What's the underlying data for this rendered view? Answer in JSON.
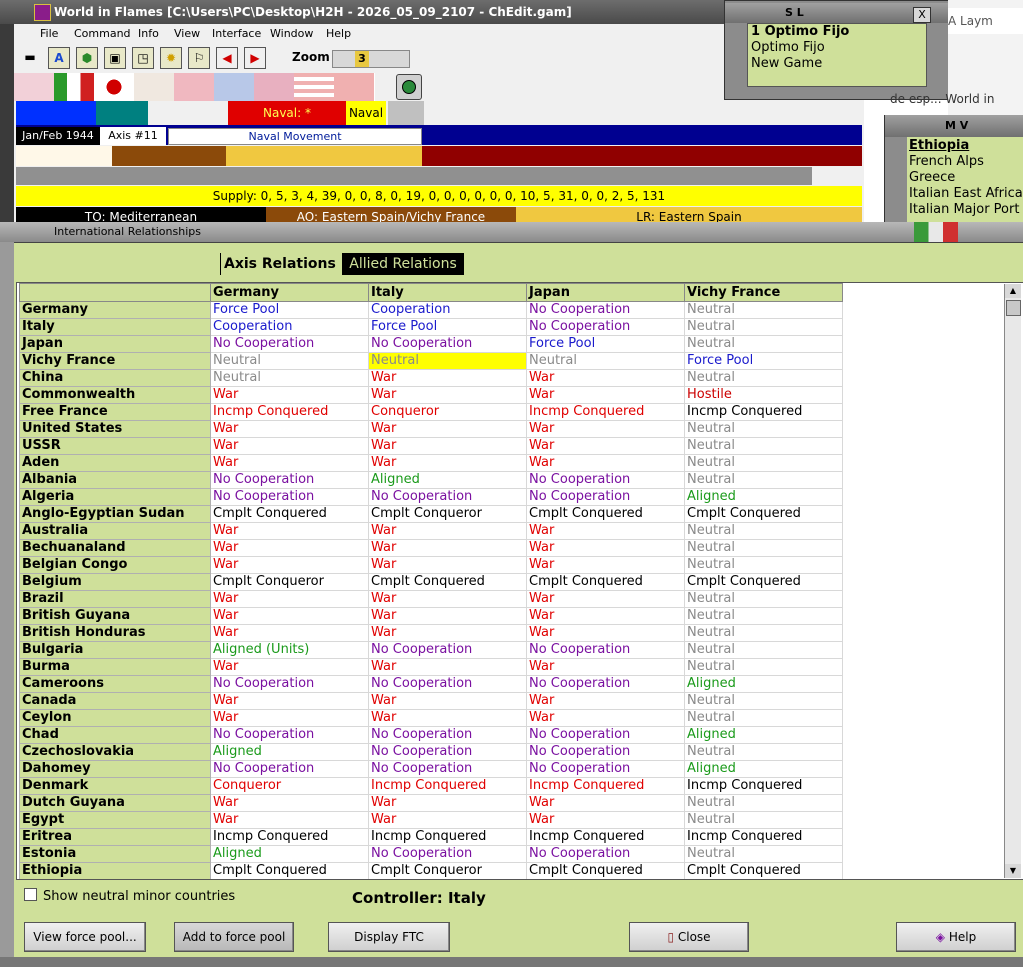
{
  "main_window": {
    "title": "World in Flames [C:\\Users\\PC\\Desktop\\H2H - 2026_05_09_2107 - ChEdit.gam]",
    "menu": [
      "File",
      "Command",
      "Info",
      "View",
      "Interface",
      "Window",
      "Help"
    ],
    "zoom_label": "Zoom",
    "zoom_value": "3",
    "naval_star": "Naval: *",
    "naval_tag": "Naval",
    "date": "Jan/Feb 1944",
    "axis_turn": "Axis #11",
    "phase": "Naval Movement",
    "supply": "Supply: 0, 5, 3, 4, 39, 0, 0, 8, 0, 19, 0, 0, 0, 0, 0, 0, 10, 5, 31, 0, 0, 2, 5, 131",
    "to": "TO: Mediterranean",
    "ao": "AO: Eastern Spain/Vichy France",
    "lr": "LR: Eastern Spain"
  },
  "sl_window": {
    "title": "S L",
    "close": "X",
    "lines": [
      "1 Optimo Fijo",
      "Optimo Fijo",
      "New Game"
    ]
  },
  "browser": {
    "tab_label": "A Laym",
    "row2": "de esp...   World in"
  },
  "mv_window": {
    "title": "M V",
    "items": [
      "Ethiopia",
      "French Alps",
      "Greece",
      "Italian East Africa",
      "Italian Major Port"
    ]
  },
  "ir_window": {
    "title": "International Relationships",
    "tab_axis": "Axis Relations",
    "tab_allied": "Allied Relations",
    "columns": [
      "Germany",
      "Italy",
      "Japan",
      "Vichy France"
    ],
    "rows": [
      {
        "name": "Germany",
        "cells": [
          [
            "Force Pool",
            "blue"
          ],
          [
            "Cooperation",
            "blue"
          ],
          [
            "No Cooperation",
            "purple"
          ],
          [
            "Neutral",
            "neutral"
          ]
        ]
      },
      {
        "name": "Italy",
        "cells": [
          [
            "Cooperation",
            "blue"
          ],
          [
            "Force Pool",
            "blue"
          ],
          [
            "No Cooperation",
            "purple"
          ],
          [
            "Neutral",
            "neutral"
          ]
        ]
      },
      {
        "name": "Japan",
        "cells": [
          [
            "No Cooperation",
            "purple"
          ],
          [
            "No Cooperation",
            "purple"
          ],
          [
            "Force Pool",
            "blue"
          ],
          [
            "Neutral",
            "neutral"
          ]
        ]
      },
      {
        "name": "Vichy France",
        "cells": [
          [
            "Neutral",
            "neutral"
          ],
          [
            "Neutral",
            "hl"
          ],
          [
            "Neutral",
            "neutral"
          ],
          [
            "Force Pool",
            "blue"
          ]
        ]
      },
      {
        "name": "China",
        "cells": [
          [
            "Neutral",
            "neutral"
          ],
          [
            "War",
            "war"
          ],
          [
            "War",
            "war"
          ],
          [
            "Neutral",
            "neutral"
          ]
        ]
      },
      {
        "name": "Commonwealth",
        "cells": [
          [
            "War",
            "war"
          ],
          [
            "War",
            "war"
          ],
          [
            "War",
            "war"
          ],
          [
            "Hostile",
            "red"
          ]
        ]
      },
      {
        "name": "Free France",
        "cells": [
          [
            "Incmp Conquered",
            "war"
          ],
          [
            "Conqueror",
            "war"
          ],
          [
            "Incmp Conquered",
            "war"
          ],
          [
            "Incmp Conquered",
            "black"
          ]
        ]
      },
      {
        "name": "United States",
        "cells": [
          [
            "War",
            "war"
          ],
          [
            "War",
            "war"
          ],
          [
            "War",
            "war"
          ],
          [
            "Neutral",
            "neutral"
          ]
        ]
      },
      {
        "name": "USSR",
        "cells": [
          [
            "War",
            "war"
          ],
          [
            "War",
            "war"
          ],
          [
            "War",
            "war"
          ],
          [
            "Neutral",
            "neutral"
          ]
        ]
      },
      {
        "name": "Aden",
        "cells": [
          [
            "War",
            "war"
          ],
          [
            "War",
            "war"
          ],
          [
            "War",
            "war"
          ],
          [
            "Neutral",
            "neutral"
          ]
        ]
      },
      {
        "name": "Albania",
        "cells": [
          [
            "No Cooperation",
            "purple"
          ],
          [
            "Aligned",
            "green"
          ],
          [
            "No Cooperation",
            "purple"
          ],
          [
            "Neutral",
            "neutral"
          ]
        ]
      },
      {
        "name": "Algeria",
        "cells": [
          [
            "No Cooperation",
            "purple"
          ],
          [
            "No Cooperation",
            "purple"
          ],
          [
            "No Cooperation",
            "purple"
          ],
          [
            "Aligned",
            "green"
          ]
        ]
      },
      {
        "name": "Anglo-Egyptian Sudan",
        "cells": [
          [
            "Cmplt Conquered",
            "black"
          ],
          [
            "Cmplt Conqueror",
            "black"
          ],
          [
            "Cmplt Conquered",
            "black"
          ],
          [
            "Cmplt Conquered",
            "black"
          ]
        ]
      },
      {
        "name": "Australia",
        "cells": [
          [
            "War",
            "war"
          ],
          [
            "War",
            "war"
          ],
          [
            "War",
            "war"
          ],
          [
            "Neutral",
            "neutral"
          ]
        ]
      },
      {
        "name": "Bechuanaland",
        "cells": [
          [
            "War",
            "war"
          ],
          [
            "War",
            "war"
          ],
          [
            "War",
            "war"
          ],
          [
            "Neutral",
            "neutral"
          ]
        ]
      },
      {
        "name": "Belgian Congo",
        "cells": [
          [
            "War",
            "war"
          ],
          [
            "War",
            "war"
          ],
          [
            "War",
            "war"
          ],
          [
            "Neutral",
            "neutral"
          ]
        ]
      },
      {
        "name": "Belgium",
        "cells": [
          [
            "Cmplt Conqueror",
            "black"
          ],
          [
            "Cmplt Conquered",
            "black"
          ],
          [
            "Cmplt Conquered",
            "black"
          ],
          [
            "Cmplt Conquered",
            "black"
          ]
        ]
      },
      {
        "name": "Brazil",
        "cells": [
          [
            "War",
            "war"
          ],
          [
            "War",
            "war"
          ],
          [
            "War",
            "war"
          ],
          [
            "Neutral",
            "neutral"
          ]
        ]
      },
      {
        "name": "British Guyana",
        "cells": [
          [
            "War",
            "war"
          ],
          [
            "War",
            "war"
          ],
          [
            "War",
            "war"
          ],
          [
            "Neutral",
            "neutral"
          ]
        ]
      },
      {
        "name": "British Honduras",
        "cells": [
          [
            "War",
            "war"
          ],
          [
            "War",
            "war"
          ],
          [
            "War",
            "war"
          ],
          [
            "Neutral",
            "neutral"
          ]
        ]
      },
      {
        "name": "Bulgaria",
        "cells": [
          [
            "Aligned (Units)",
            "green"
          ],
          [
            "No Cooperation",
            "purple"
          ],
          [
            "No Cooperation",
            "purple"
          ],
          [
            "Neutral",
            "neutral"
          ]
        ]
      },
      {
        "name": "Burma",
        "cells": [
          [
            "War",
            "war"
          ],
          [
            "War",
            "war"
          ],
          [
            "War",
            "war"
          ],
          [
            "Neutral",
            "neutral"
          ]
        ]
      },
      {
        "name": "Cameroons",
        "cells": [
          [
            "No Cooperation",
            "purple"
          ],
          [
            "No Cooperation",
            "purple"
          ],
          [
            "No Cooperation",
            "purple"
          ],
          [
            "Aligned",
            "green"
          ]
        ]
      },
      {
        "name": "Canada",
        "cells": [
          [
            "War",
            "war"
          ],
          [
            "War",
            "war"
          ],
          [
            "War",
            "war"
          ],
          [
            "Neutral",
            "neutral"
          ]
        ]
      },
      {
        "name": "Ceylon",
        "cells": [
          [
            "War",
            "war"
          ],
          [
            "War",
            "war"
          ],
          [
            "War",
            "war"
          ],
          [
            "Neutral",
            "neutral"
          ]
        ]
      },
      {
        "name": "Chad",
        "cells": [
          [
            "No Cooperation",
            "purple"
          ],
          [
            "No Cooperation",
            "purple"
          ],
          [
            "No Cooperation",
            "purple"
          ],
          [
            "Aligned",
            "green"
          ]
        ]
      },
      {
        "name": "Czechoslovakia",
        "cells": [
          [
            "Aligned",
            "green"
          ],
          [
            "No Cooperation",
            "purple"
          ],
          [
            "No Cooperation",
            "purple"
          ],
          [
            "Neutral",
            "neutral"
          ]
        ]
      },
      {
        "name": "Dahomey",
        "cells": [
          [
            "No Cooperation",
            "purple"
          ],
          [
            "No Cooperation",
            "purple"
          ],
          [
            "No Cooperation",
            "purple"
          ],
          [
            "Aligned",
            "green"
          ]
        ]
      },
      {
        "name": "Denmark",
        "cells": [
          [
            "Conqueror",
            "war"
          ],
          [
            "Incmp Conquered",
            "war"
          ],
          [
            "Incmp Conquered",
            "war"
          ],
          [
            "Incmp Conquered",
            "black"
          ]
        ]
      },
      {
        "name": "Dutch Guyana",
        "cells": [
          [
            "War",
            "war"
          ],
          [
            "War",
            "war"
          ],
          [
            "War",
            "war"
          ],
          [
            "Neutral",
            "neutral"
          ]
        ]
      },
      {
        "name": "Egypt",
        "cells": [
          [
            "War",
            "war"
          ],
          [
            "War",
            "war"
          ],
          [
            "War",
            "war"
          ],
          [
            "Neutral",
            "neutral"
          ]
        ]
      },
      {
        "name": "Eritrea",
        "cells": [
          [
            "Incmp Conquered",
            "black"
          ],
          [
            "Incmp Conquered",
            "black"
          ],
          [
            "Incmp Conquered",
            "black"
          ],
          [
            "Incmp Conquered",
            "black"
          ]
        ]
      },
      {
        "name": "Estonia",
        "cells": [
          [
            "Aligned",
            "green"
          ],
          [
            "No Cooperation",
            "purple"
          ],
          [
            "No Cooperation",
            "purple"
          ],
          [
            "Neutral",
            "neutral"
          ]
        ]
      },
      {
        "name": "Ethiopia",
        "cells": [
          [
            "Cmplt Conquered",
            "black"
          ],
          [
            "Cmplt Conqueror",
            "black"
          ],
          [
            "Cmplt Conquered",
            "black"
          ],
          [
            "Cmplt Conquered",
            "black"
          ]
        ]
      }
    ],
    "show_neutral_label": "Show neutral minor countries",
    "controller": "Controller: Italy",
    "buttons": {
      "view_force_pool": "View force pool...",
      "add_to_force_pool": "Add to force pool",
      "display_ftc": "Display FTC",
      "close": "Close",
      "help": "Help"
    }
  }
}
